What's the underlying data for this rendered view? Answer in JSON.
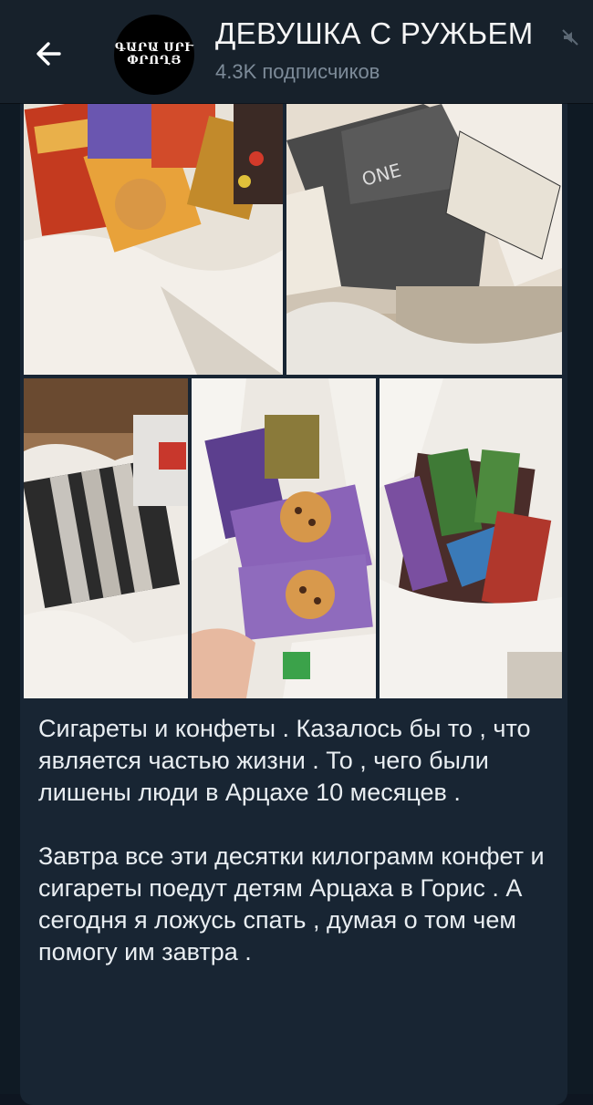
{
  "header": {
    "back_icon": "arrow-left-icon",
    "avatar_text_line1": "ԳԱՐԱ ՍՐՒ",
    "avatar_text_line2": "ՓՐՈՂՅ",
    "title": "ДЕВУШКА С РУЖЬЕМ",
    "subscribers": "4.3K подписчиков",
    "mute_icon": "muted-bell-icon"
  },
  "photos": [
    {
      "name": "photo-sweets-top-left",
      "desc": "snack packages in bag"
    },
    {
      "name": "photo-cigarette-cartons-top-right",
      "desc": "cigarette cartons"
    },
    {
      "name": "photo-cigarettes-in-bag",
      "desc": "cigarette packs in bag"
    },
    {
      "name": "photo-milka-cookies",
      "desc": "Milka cookies in bag"
    },
    {
      "name": "photo-alpen-gold-chocolate",
      "desc": "chocolate bars in bag"
    }
  ],
  "caption": {
    "para1": "Сигареты и конфеты . Казалось бы то , что является частью жизни . То , чего были лишены люди в Арцахе 10 месяцев .",
    "para2": "Завтра все эти десятки килограмм конфет и сигареты поедут  детям Арцаха в Горис . А сегодня я ложусь спать , думая о том чем помогу им завтра ."
  },
  "colors": {
    "header_bg": "#17212b",
    "bubble_bg": "#182533",
    "title_text": "#f5f5f5",
    "subtitle_text": "#7d8b99"
  }
}
